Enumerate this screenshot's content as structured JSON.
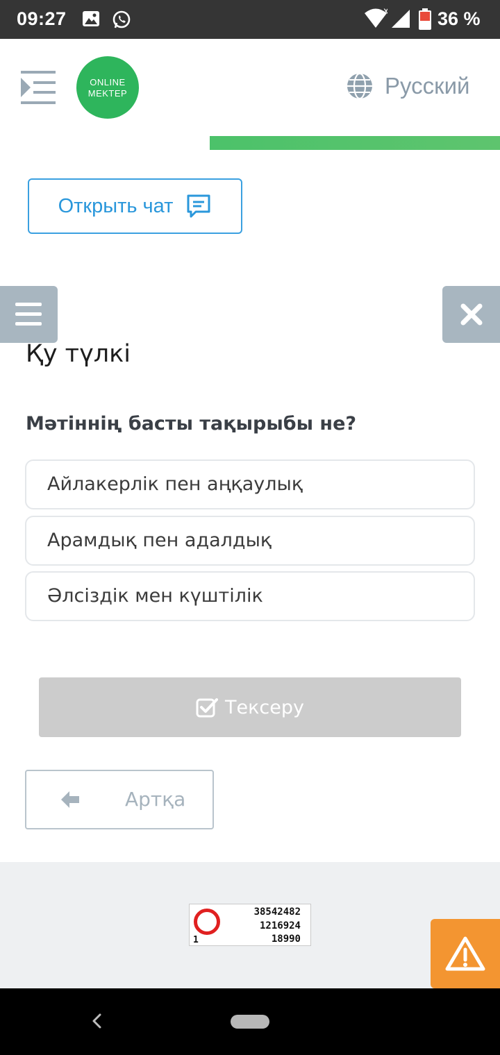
{
  "status_bar": {
    "time": "09:27",
    "battery": "36 %"
  },
  "header": {
    "logo_line1": "ONLINE",
    "logo_line2": "MEKTEP",
    "language": "Русский",
    "progress_fraction": 0.58
  },
  "chat": {
    "label": "Открыть чат"
  },
  "lesson": {
    "title": "Қу түлкі",
    "question": "Мәтіннің басты тақырыбы не?",
    "options": [
      {
        "label": "Айлакерлік пен аңқаулық"
      },
      {
        "label": "Арамдық пен адалдық"
      },
      {
        "label": "Әлсіздік мен күштілік"
      }
    ]
  },
  "actions": {
    "check_label": "Тексеру",
    "back_label": "Артқа"
  },
  "counter": {
    "line1": "38542482",
    "line2": "1216924",
    "line3": "18990",
    "left": "1"
  },
  "colors": {
    "brand_green": "#2eb55c",
    "accent_blue": "#2a97db",
    "warning_orange": "#f39531"
  }
}
